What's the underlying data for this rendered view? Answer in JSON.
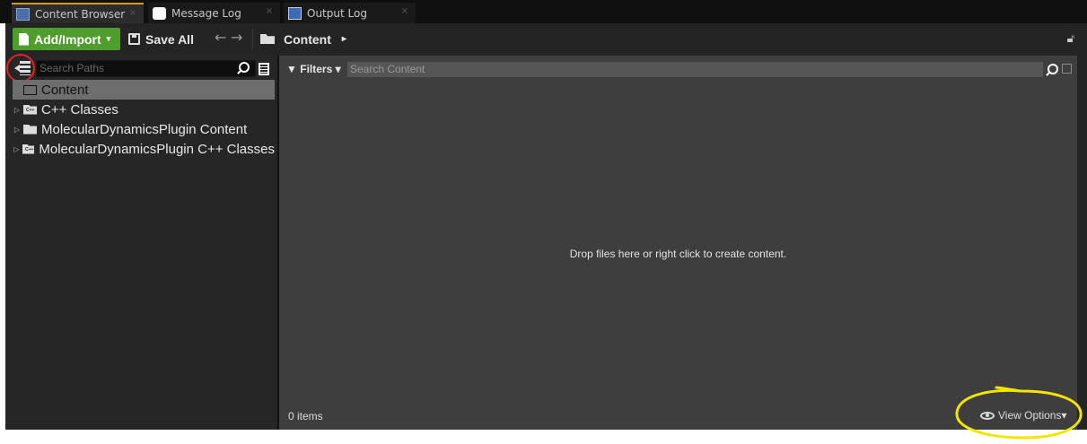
{
  "tabs": [
    {
      "label": "Content Browser",
      "close": "×",
      "icon": "content-browser-icon",
      "active": true
    },
    {
      "label": "Message Log",
      "close": "×",
      "icon": "message-log-icon",
      "active": false
    },
    {
      "label": "Output Log",
      "close": "×",
      "icon": "output-log-icon",
      "active": false
    }
  ],
  "toolbar": {
    "add_label": "Add/Import",
    "add_caret": "▾",
    "save_label": "Save All",
    "back": "←",
    "forward": "→",
    "breadcrumb": "Content",
    "breadcrumb_arrow": "▸",
    "lock_icon": "lock-icon"
  },
  "left_panel": {
    "search_placeholder": "Search Paths",
    "tree": [
      {
        "label": "Content",
        "expander": "",
        "selected": true,
        "icon": "folder-open-icon"
      },
      {
        "label": "C++ Classes",
        "expander": "▷",
        "selected": false,
        "icon": "cpp-folder-icon"
      },
      {
        "label": "MolecularDynamicsPlugin Content",
        "expander": "▷",
        "selected": false,
        "icon": "folder-icon"
      },
      {
        "label": "MolecularDynamicsPlugin C++ Classes",
        "expander": "▷",
        "selected": false,
        "icon": "cpp-folder-icon"
      }
    ]
  },
  "right_panel": {
    "filters_label": "Filters",
    "filters_caret": "▾",
    "search_placeholder": "Search Content",
    "empty_message": "Drop files here or right click to create content.",
    "item_count": "0 items",
    "view_options": "View Options",
    "view_caret": "▾"
  },
  "colors": {
    "accent_tab": "#d89a1a",
    "add_button": "#4f9d2d",
    "annotation_red": "#e32121",
    "annotation_yellow": "#f2e600"
  }
}
